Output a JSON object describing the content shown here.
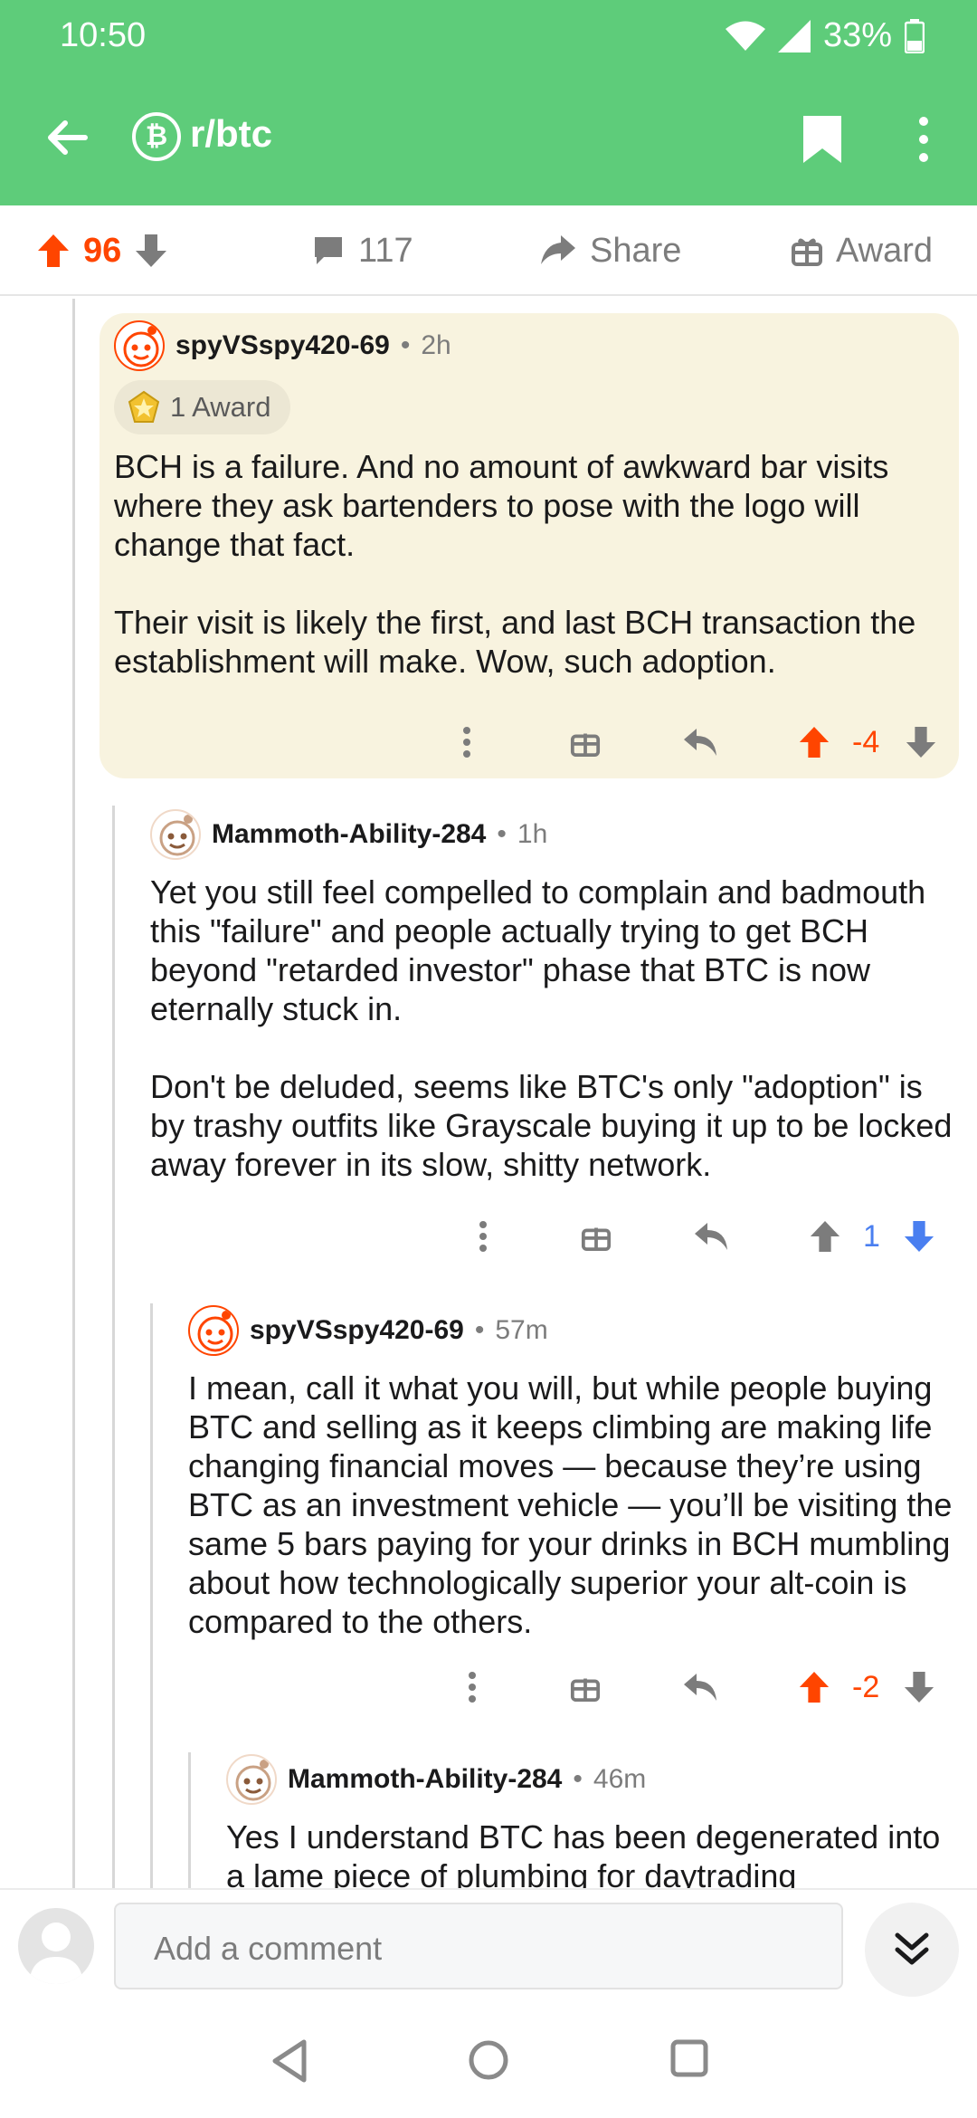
{
  "status": {
    "time": "10:50",
    "battery": "33%"
  },
  "header": {
    "subreddit": "r/btc",
    "badge": "₿"
  },
  "actions": {
    "score": "96",
    "comments": "117",
    "share": "Share",
    "award": "Award"
  },
  "comments": [
    {
      "author": "spyVSspy420-69",
      "age": "2h",
      "award": "1 Award",
      "paragraphs": [
        "BCH is a failure. And no amount of awkward bar visits where they ask bartenders to pose with the logo will change that fact.",
        "Their visit is likely the first, and last BCH transaction the establishment will make. Wow, such adoption."
      ],
      "score": "-4",
      "vote_state": "upvoted"
    },
    {
      "author": "Mammoth-Ability-284",
      "age": "1h",
      "paragraphs": [
        "Yet you still feel compelled to complain and badmouth this \"failure\" and people actually trying to get BCH beyond \"retarded investor\" phase that BTC is now eternally stuck in.",
        "Don't be deluded, seems like BTC's only \"adoption\" is by trashy outfits like Grayscale buying it up to be locked away forever in its slow, shitty network."
      ],
      "score": "1",
      "vote_state": "downvoted"
    },
    {
      "author": "spyVSspy420-69",
      "age": "57m",
      "paragraphs": [
        "I mean, call it what you will, but while people buying BTC and selling as it keeps climbing are making life changing financial moves — because they’re using BTC as an investment vehicle — you’ll be visiting the same 5 bars paying for your drinks in BCH mumbling about how technologically superior your alt-coin is compared to the others."
      ],
      "score": "-2",
      "vote_state": "upvoted"
    },
    {
      "author": "Mammoth-Ability-284",
      "age": "46m",
      "paragraphs": [
        "Yes I understand BTC has been degenerated into a lame piece of plumbing for daytrading"
      ]
    }
  ],
  "composer": {
    "placeholder": "Add a comment"
  },
  "colors": {
    "header": "#5ecc7a",
    "upvote": "#ff4500",
    "downvote": "#4a7ff0",
    "highlight": "#f8f3df"
  }
}
